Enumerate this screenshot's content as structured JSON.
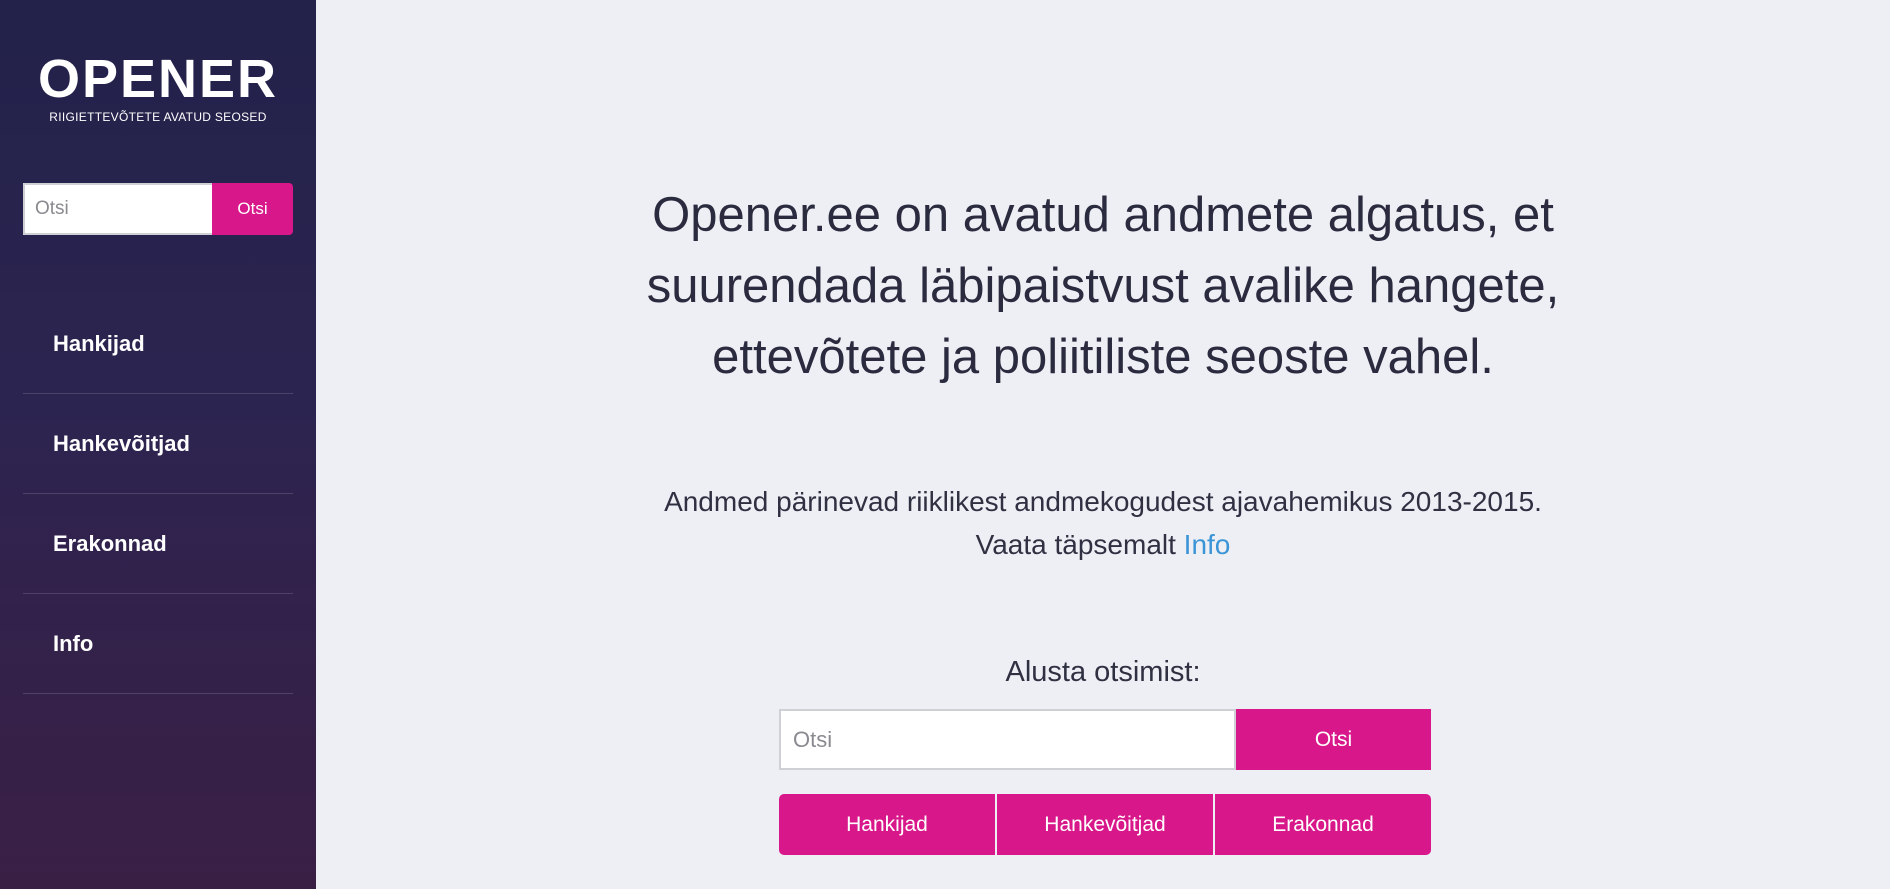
{
  "logo": {
    "title": "OPENER",
    "subtitle": "RIIGIETTEVÕTETE AVATUD SEOSED"
  },
  "sidebar": {
    "search": {
      "placeholder": "Otsi",
      "button_label": "Otsi"
    },
    "items": [
      {
        "label": "Hankijad"
      },
      {
        "label": "Hankevõitjad"
      },
      {
        "label": "Erakonnad"
      },
      {
        "label": "Info"
      }
    ]
  },
  "main": {
    "headline_lines": [
      "Opener.ee on avatud andmete algatus, et",
      "suurendada läbipaistvust avalike hangete,",
      "ettevõtete ja poliitiliste seoste vahel."
    ],
    "intro_line1": "Andmed pärinevad riiklikest andmekogudest ajavahemikus 2013-2015.",
    "intro_line2_prefix": "Vaata täpsemalt",
    "intro_link": "Info",
    "start_label": "Alusta otsimist:",
    "search": {
      "placeholder": "Otsi",
      "button_label": "Otsi"
    },
    "quick_buttons": [
      "Hankijad",
      "Hankevõitjad",
      "Erakonnad"
    ]
  },
  "colors": {
    "accent": "#d8178a",
    "link": "#3a94d6",
    "sidebar_top": "#22224a",
    "sidebar_bottom": "#3a1f45",
    "background": "#eeeff4"
  }
}
